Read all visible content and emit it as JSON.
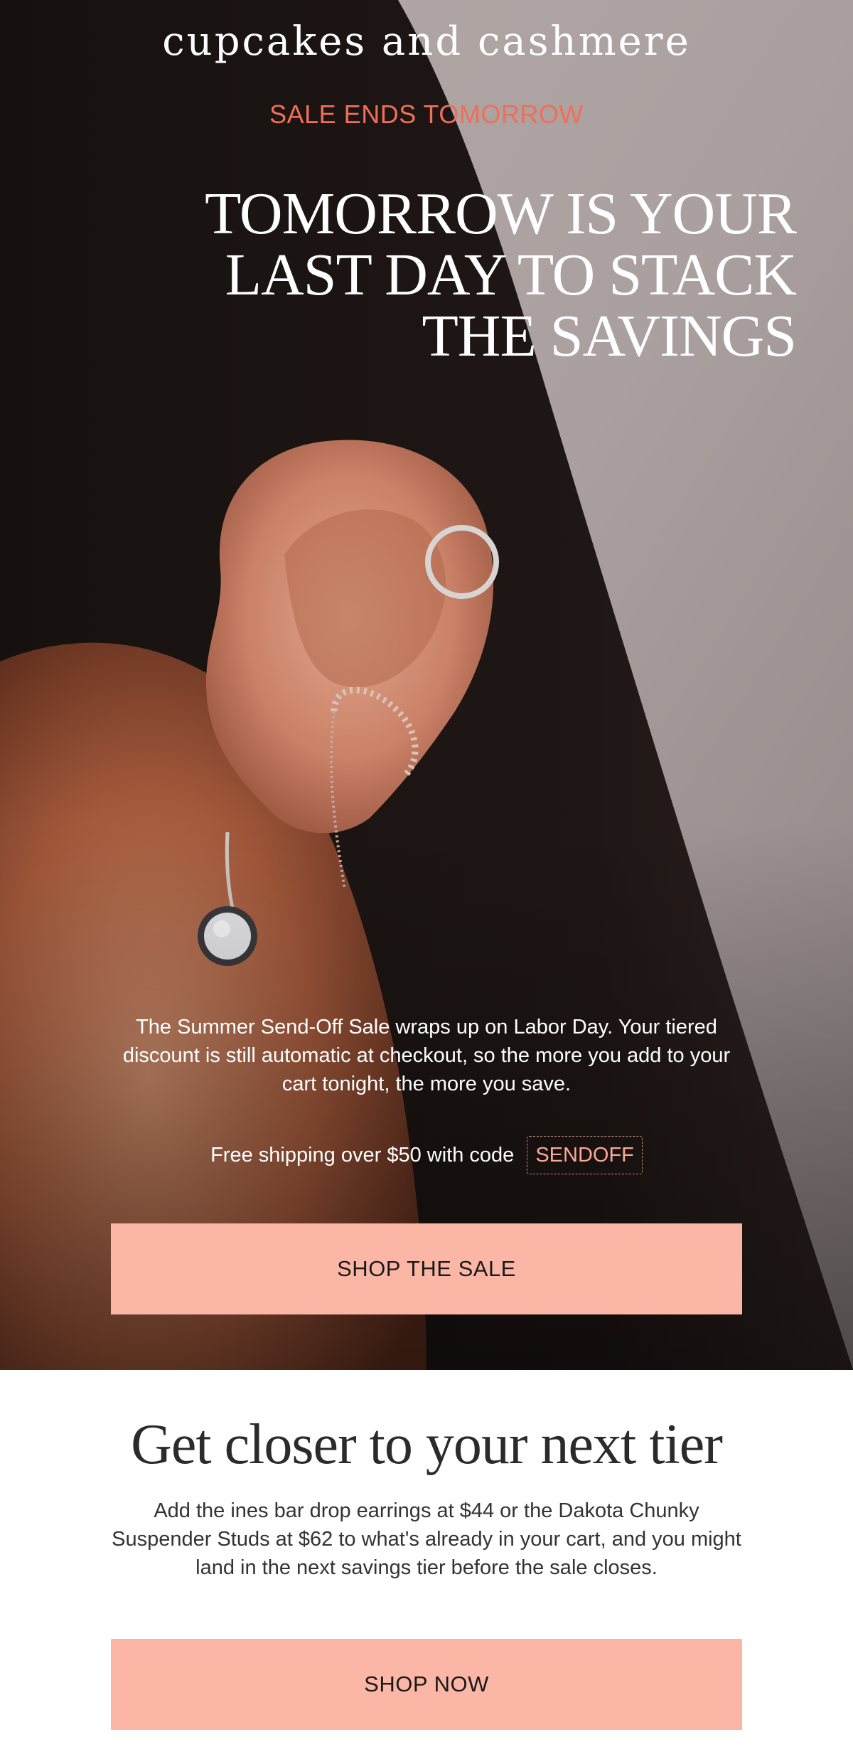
{
  "brand": {
    "name": "cupcakes and cashmere"
  },
  "hero": {
    "eyebrow": "SALE ENDS TOMORROW",
    "headline_lines": [
      "TOMORROW IS YOUR",
      "LAST DAY TO STACK",
      "THE SAVINGS"
    ],
    "body": "The Summer Send-Off Sale wraps up on Labor Day. Your tiered discount is still automatic at checkout, so the more you add to your cart tonight, the more you save.",
    "shipping_text": "Free shipping over $50 with code",
    "promo_code": "SENDOFF",
    "cta_label": "SHOP THE SALE",
    "image_subject": "ear-with-earrings-photo"
  },
  "tier": {
    "title": "Get closer to your next tier",
    "body": "Add the ines bar drop earrings at $44 or the Dakota Chunky Suspender Studs at $62 to what's already in your cart, and you might land in the next savings tier before the sale closes.",
    "cta_label": "SHOP NOW"
  },
  "colors": {
    "accent_coral": "#ef6f58",
    "button_peach": "#fcb6a6",
    "promo_text": "#f9a896",
    "heading_dark": "#2b2b2b",
    "white": "#ffffff"
  }
}
